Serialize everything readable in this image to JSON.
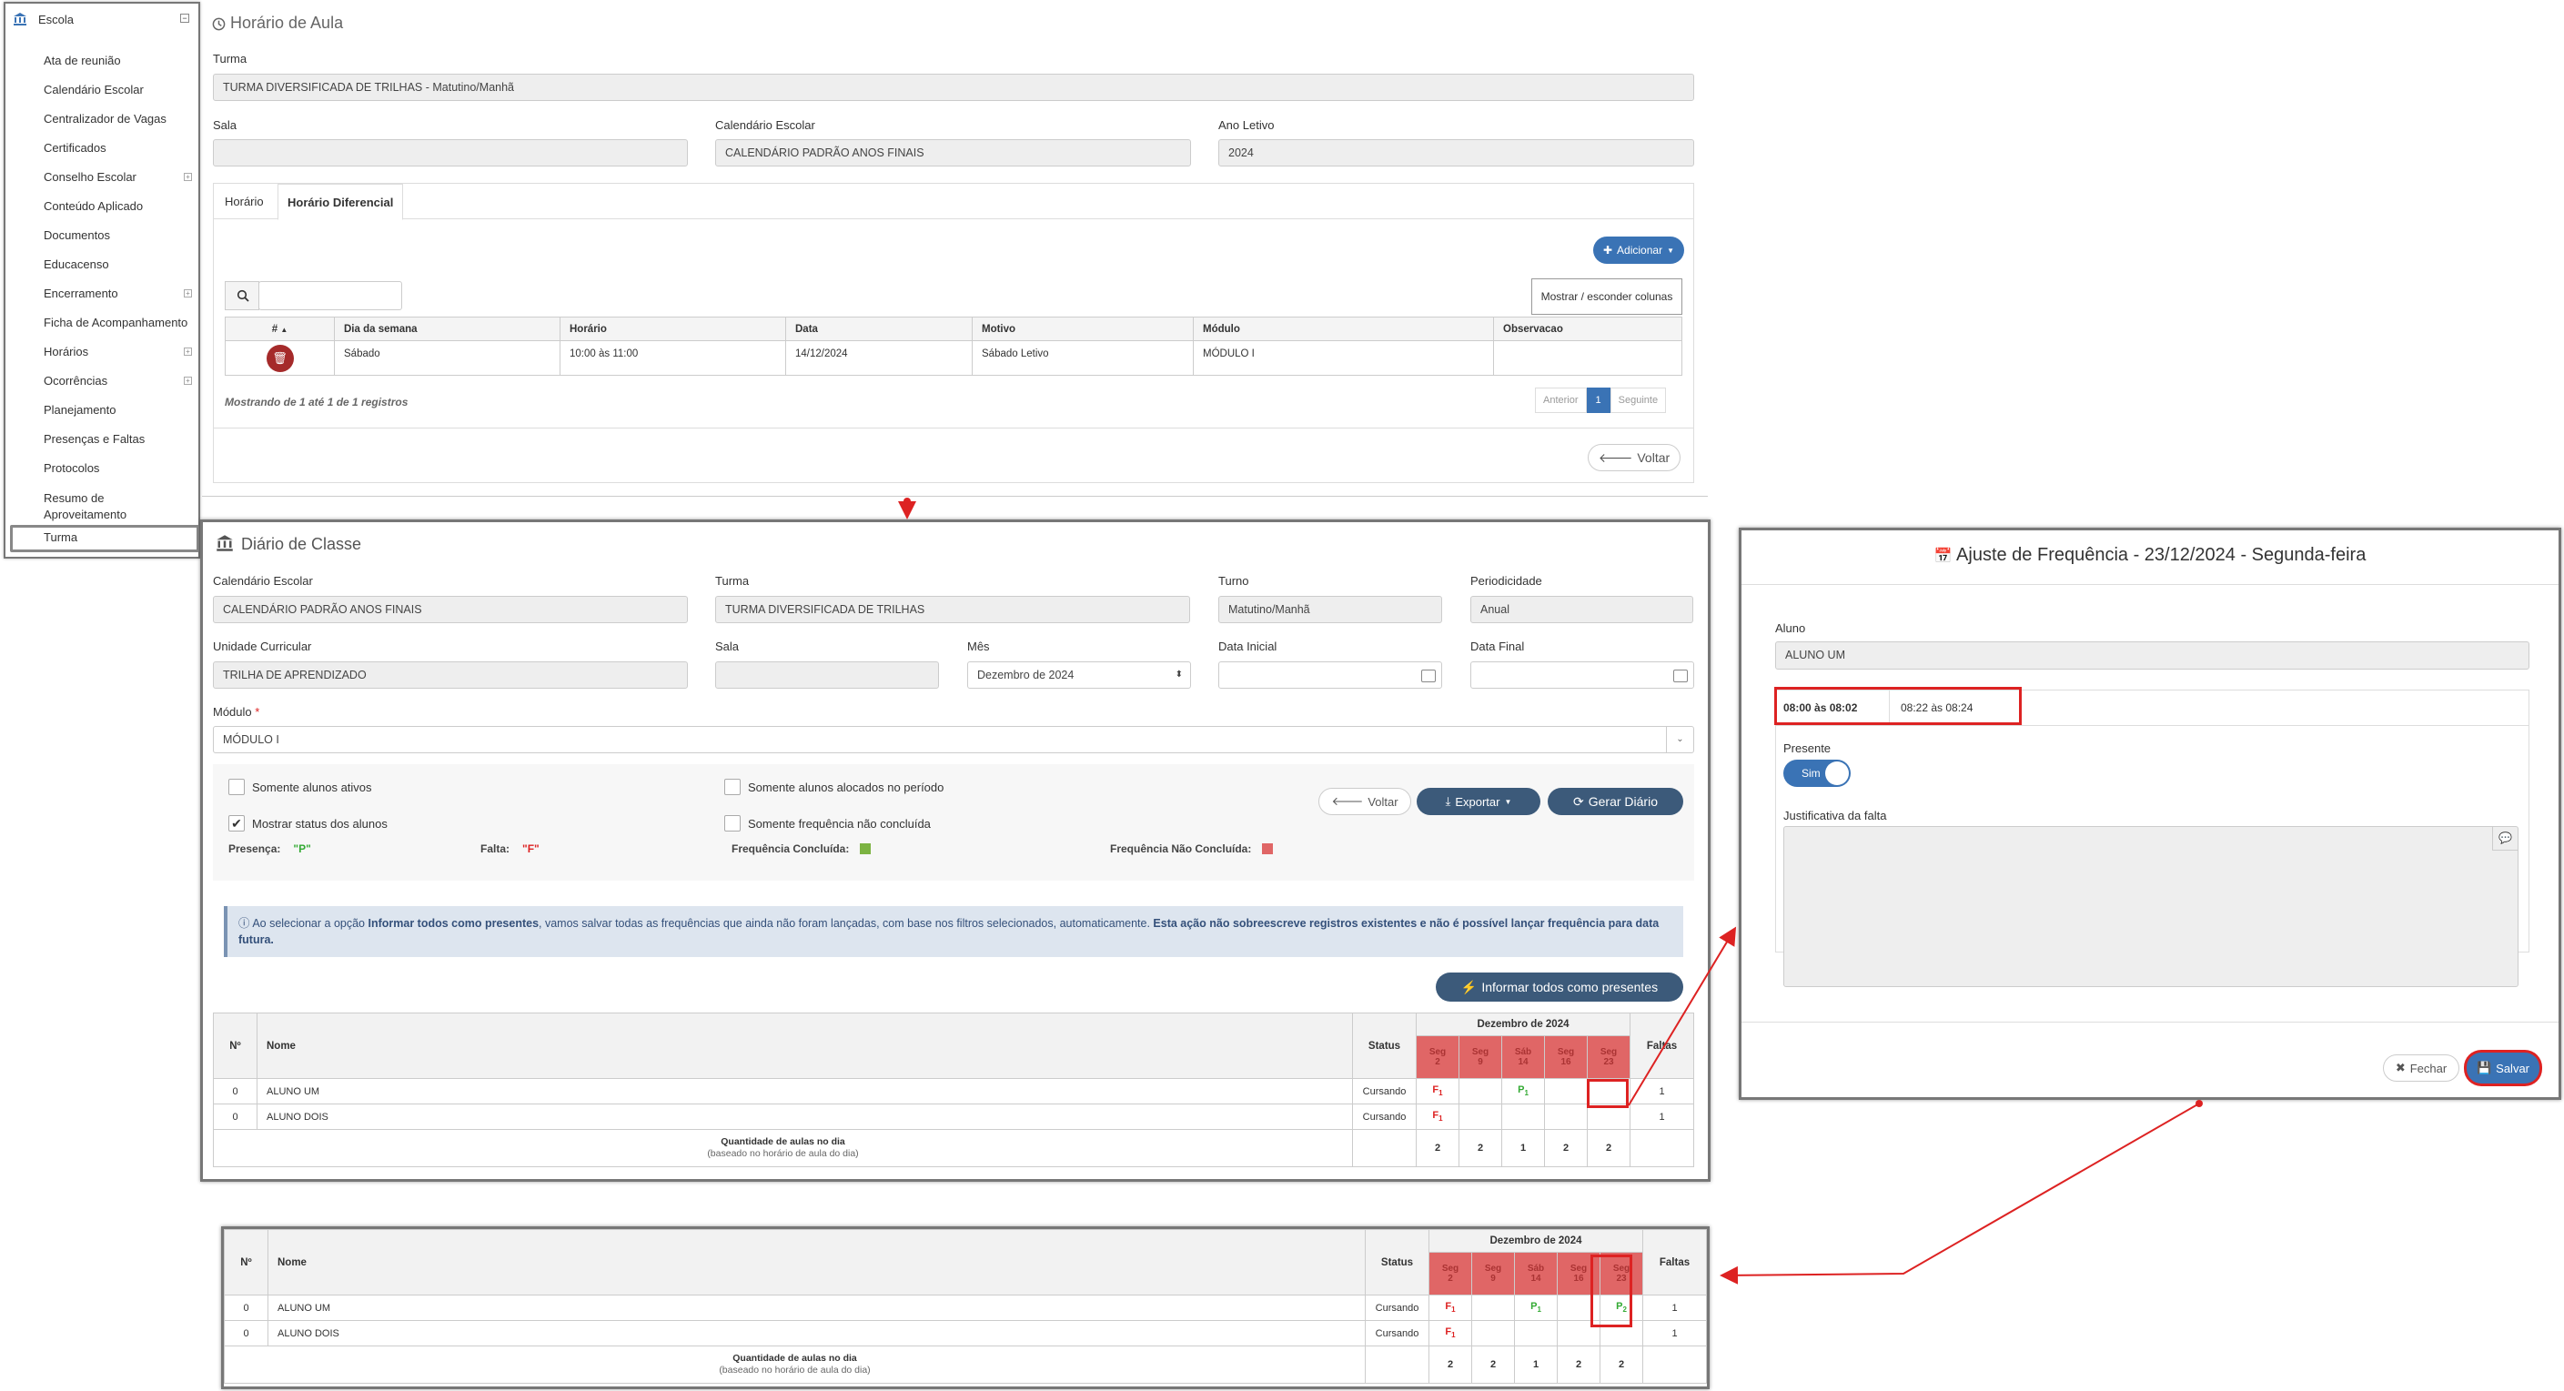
{
  "sidebar": {
    "title": "Escola",
    "items": [
      {
        "label": "Ata de reunião",
        "expand": false
      },
      {
        "label": "Calendário Escolar",
        "expand": false
      },
      {
        "label": "Centralizador de Vagas",
        "expand": false
      },
      {
        "label": "Certificados",
        "expand": false
      },
      {
        "label": "Conselho Escolar",
        "expand": true
      },
      {
        "label": "Conteúdo Aplicado",
        "expand": false
      },
      {
        "label": "Documentos",
        "expand": false
      },
      {
        "label": "Educacenso",
        "expand": false
      },
      {
        "label": "Encerramento",
        "expand": true
      },
      {
        "label": "Ficha de Acompanhamento",
        "expand": false
      },
      {
        "label": "Horários",
        "expand": true
      },
      {
        "label": "Ocorrências",
        "expand": true
      },
      {
        "label": "Planejamento",
        "expand": false
      },
      {
        "label": "Presenças e Faltas",
        "expand": false
      },
      {
        "label": "Protocolos",
        "expand": false
      },
      {
        "label": "Resumo de Aproveitamento",
        "expand": false
      },
      {
        "label": "Turma",
        "expand": false
      }
    ]
  },
  "horario": {
    "title": "Horário de Aula",
    "turma_label": "Turma",
    "turma_value": "TURMA DIVERSIFICADA DE TRILHAS - Matutino/Manhã",
    "sala_label": "Sala",
    "sala_value": "",
    "calendario_label": "Calendário Escolar",
    "calendario_value": "CALENDÁRIO PADRÃO ANOS FINAIS",
    "ano_label": "Ano Letivo",
    "ano_value": "2024",
    "tabs": [
      "Horário",
      "Horário Diferencial"
    ],
    "adicionar": "Adicionar",
    "search_value": "",
    "colunas_button": "Mostrar / esconder colunas",
    "columns": [
      "#",
      "Dia da semana",
      "Horário",
      "Data",
      "Motivo",
      "Módulo",
      "Observacao"
    ],
    "row": {
      "dia": "Sábado",
      "horario": "10:00 às 11:00",
      "data": "14/12/2024",
      "motivo": "Sábado Letivo",
      "modulo": "MÓDULO I",
      "obs": ""
    },
    "info": "Mostrando de 1 até 1 de 1 registros",
    "pagination": {
      "prev": "Anterior",
      "page": "1",
      "next": "Seguinte"
    },
    "voltar": "Voltar"
  },
  "diario": {
    "title": "Diário de Classe",
    "fields": {
      "calendario_label": "Calendário Escolar",
      "calendario_value": "CALENDÁRIO PADRÃO ANOS FINAIS",
      "turma_label": "Turma",
      "turma_value": "TURMA DIVERSIFICADA DE TRILHAS",
      "turno_label": "Turno",
      "turno_value": "Matutino/Manhã",
      "periodicidade_label": "Periodicidade",
      "periodicidade_value": "Anual",
      "uc_label": "Unidade Curricular",
      "uc_value": "TRILHA DE APRENDIZADO",
      "sala_label": "Sala",
      "sala_value": "",
      "mes_label": "Mês",
      "mes_value": "Dezembro de 2024",
      "dini_label": "Data Inicial",
      "dini_value": "",
      "dfim_label": "Data Final",
      "dfim_value": "",
      "modulo_label": "Módulo",
      "modulo_required": "*",
      "modulo_value": "MÓDULO I"
    },
    "filters": {
      "ativos": "Somente alunos ativos",
      "alocados": "Somente alunos alocados no período",
      "status": "Mostrar status dos alunos",
      "naoconcluida": "Somente frequência não concluída"
    },
    "buttons": {
      "voltar": "Voltar",
      "exportar": "Exportar",
      "gerar": "Gerar Diário",
      "informar": "Informar todos como presentes"
    },
    "legend": {
      "presenca_label": "Presença:",
      "presenca_value": "\"P\"",
      "falta_label": "Falta:",
      "falta_value": "\"F\"",
      "concluida": "Frequência Concluída:",
      "naoconcluida": "Frequência Não Concluída:",
      "concluida_color": "#7cb342",
      "naoconcluida_color": "#e06666"
    },
    "alert": {
      "t1": "Ao selecionar a opção ",
      "b1": "Informar todos como presentes",
      "t2": ", vamos salvar todas as frequências que ainda não foram lançadas, com base nos filtros selecionados, automaticamente. ",
      "b2": "Esta ação não sobreescreve registros existentes e não é possível lançar frequência para data futura."
    },
    "table": {
      "h_num": "Nº",
      "h_nome": "Nome",
      "h_status": "Status",
      "h_month": "Dezembro de 2024",
      "h_faltas": "Faltas",
      "days": [
        {
          "w": "Seg",
          "d": "2"
        },
        {
          "w": "Seg",
          "d": "9"
        },
        {
          "w": "Sáb",
          "d": "14"
        },
        {
          "w": "Seg",
          "d": "16"
        },
        {
          "w": "Seg",
          "d": "23"
        }
      ],
      "rows": [
        {
          "num": "0",
          "nome": "ALUNO UM",
          "status": "Cursando",
          "marks": [
            "F1",
            "",
            "P1",
            "",
            ""
          ],
          "faltas": "1"
        },
        {
          "num": "0",
          "nome": "ALUNO DOIS",
          "status": "Cursando",
          "marks": [
            "F1",
            "",
            "",
            "",
            ""
          ],
          "faltas": "1"
        }
      ],
      "qtd_label": "Quantidade de aulas no dia",
      "qtd_sub": "(baseado no horário de aula do dia)",
      "qtd_values": [
        "2",
        "2",
        "1",
        "2",
        "2"
      ]
    }
  },
  "table2": {
    "rows": [
      {
        "num": "0",
        "nome": "ALUNO UM",
        "status": "Cursando",
        "marks": [
          "F1",
          "",
          "P1",
          "",
          "P2"
        ],
        "faltas": "1"
      },
      {
        "num": "0",
        "nome": "ALUNO DOIS",
        "status": "Cursando",
        "marks": [
          "F1",
          "",
          "",
          "",
          ""
        ],
        "faltas": "1"
      }
    ]
  },
  "modal": {
    "title": "Ajuste de Frequência - 23/12/2024 - Segunda-feira",
    "aluno_label": "Aluno",
    "aluno_value": "ALUNO UM",
    "slot1": "08:00 às 08:02",
    "slot2": "08:22 às 08:24",
    "presente_label": "Presente",
    "toggle": "Sim",
    "justificativa_label": "Justificativa da falta",
    "justificativa_value": "",
    "fechar": "Fechar",
    "salvar": "Salvar"
  }
}
